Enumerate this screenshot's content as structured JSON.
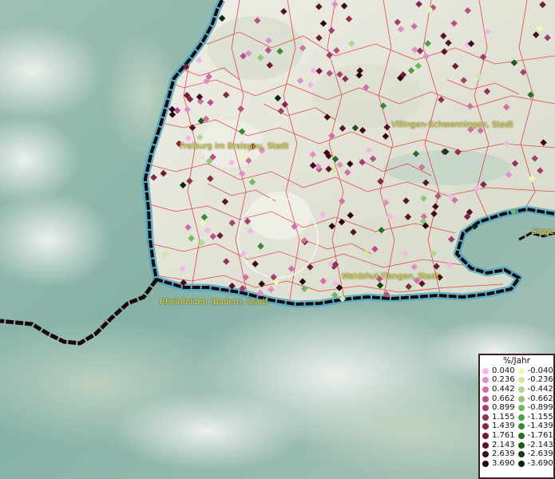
{
  "map": {
    "cities": [
      {
        "id": "freiburg",
        "name": "Freiburg im Breisgau, Stadt"
      },
      {
        "id": "villingen",
        "name": "Villingen-Schwenningen, Stadt"
      },
      {
        "id": "waldshut",
        "name": "Waldshut-Tiengen, Stadt"
      },
      {
        "id": "rheinfelden",
        "name": "Rheinfelden (Baden), Stadt"
      },
      {
        "id": "singen",
        "name": "Singe"
      }
    ],
    "colors": {
      "boundary": "#e03030",
      "border_line": "#1a0a0a",
      "water": "#4aa8c8"
    }
  },
  "legend": {
    "title": "%/Jahr",
    "positive": [
      {
        "label": "0.040",
        "color": "#f0b8e8"
      },
      {
        "label": "0.236",
        "color": "#e090c8"
      },
      {
        "label": "0.442",
        "color": "#d070a8"
      },
      {
        "label": "0.662",
        "color": "#b85088"
      },
      {
        "label": "0.899",
        "color": "#a04070"
      },
      {
        "label": "1.155",
        "color": "#903058"
      },
      {
        "label": "1.439",
        "color": "#802848"
      },
      {
        "label": "1.761",
        "color": "#6a1c38"
      },
      {
        "label": "2.143",
        "color": "#561428"
      },
      {
        "label": "2.639",
        "color": "#400c1c"
      },
      {
        "label": "3.690",
        "color": "#2a0610"
      }
    ],
    "negative": [
      {
        "label": "-0.040",
        "color": "#eef8b0"
      },
      {
        "label": "-0.236",
        "color": "#d0e8a0"
      },
      {
        "label": "-0.442",
        "color": "#b0d890"
      },
      {
        "label": "-0.662",
        "color": "#90c878"
      },
      {
        "label": "-0.899",
        "color": "#70b860"
      },
      {
        "label": "-1.155",
        "color": "#50a048"
      },
      {
        "label": "-1.439",
        "color": "#388838"
      },
      {
        "label": "-1.761",
        "color": "#287028"
      },
      {
        "label": "-2.143",
        "color": "#1a5a1a"
      },
      {
        "label": "-2.639",
        "color": "#0e4010"
      },
      {
        "label": "-3.690",
        "color": "#062808"
      }
    ]
  }
}
